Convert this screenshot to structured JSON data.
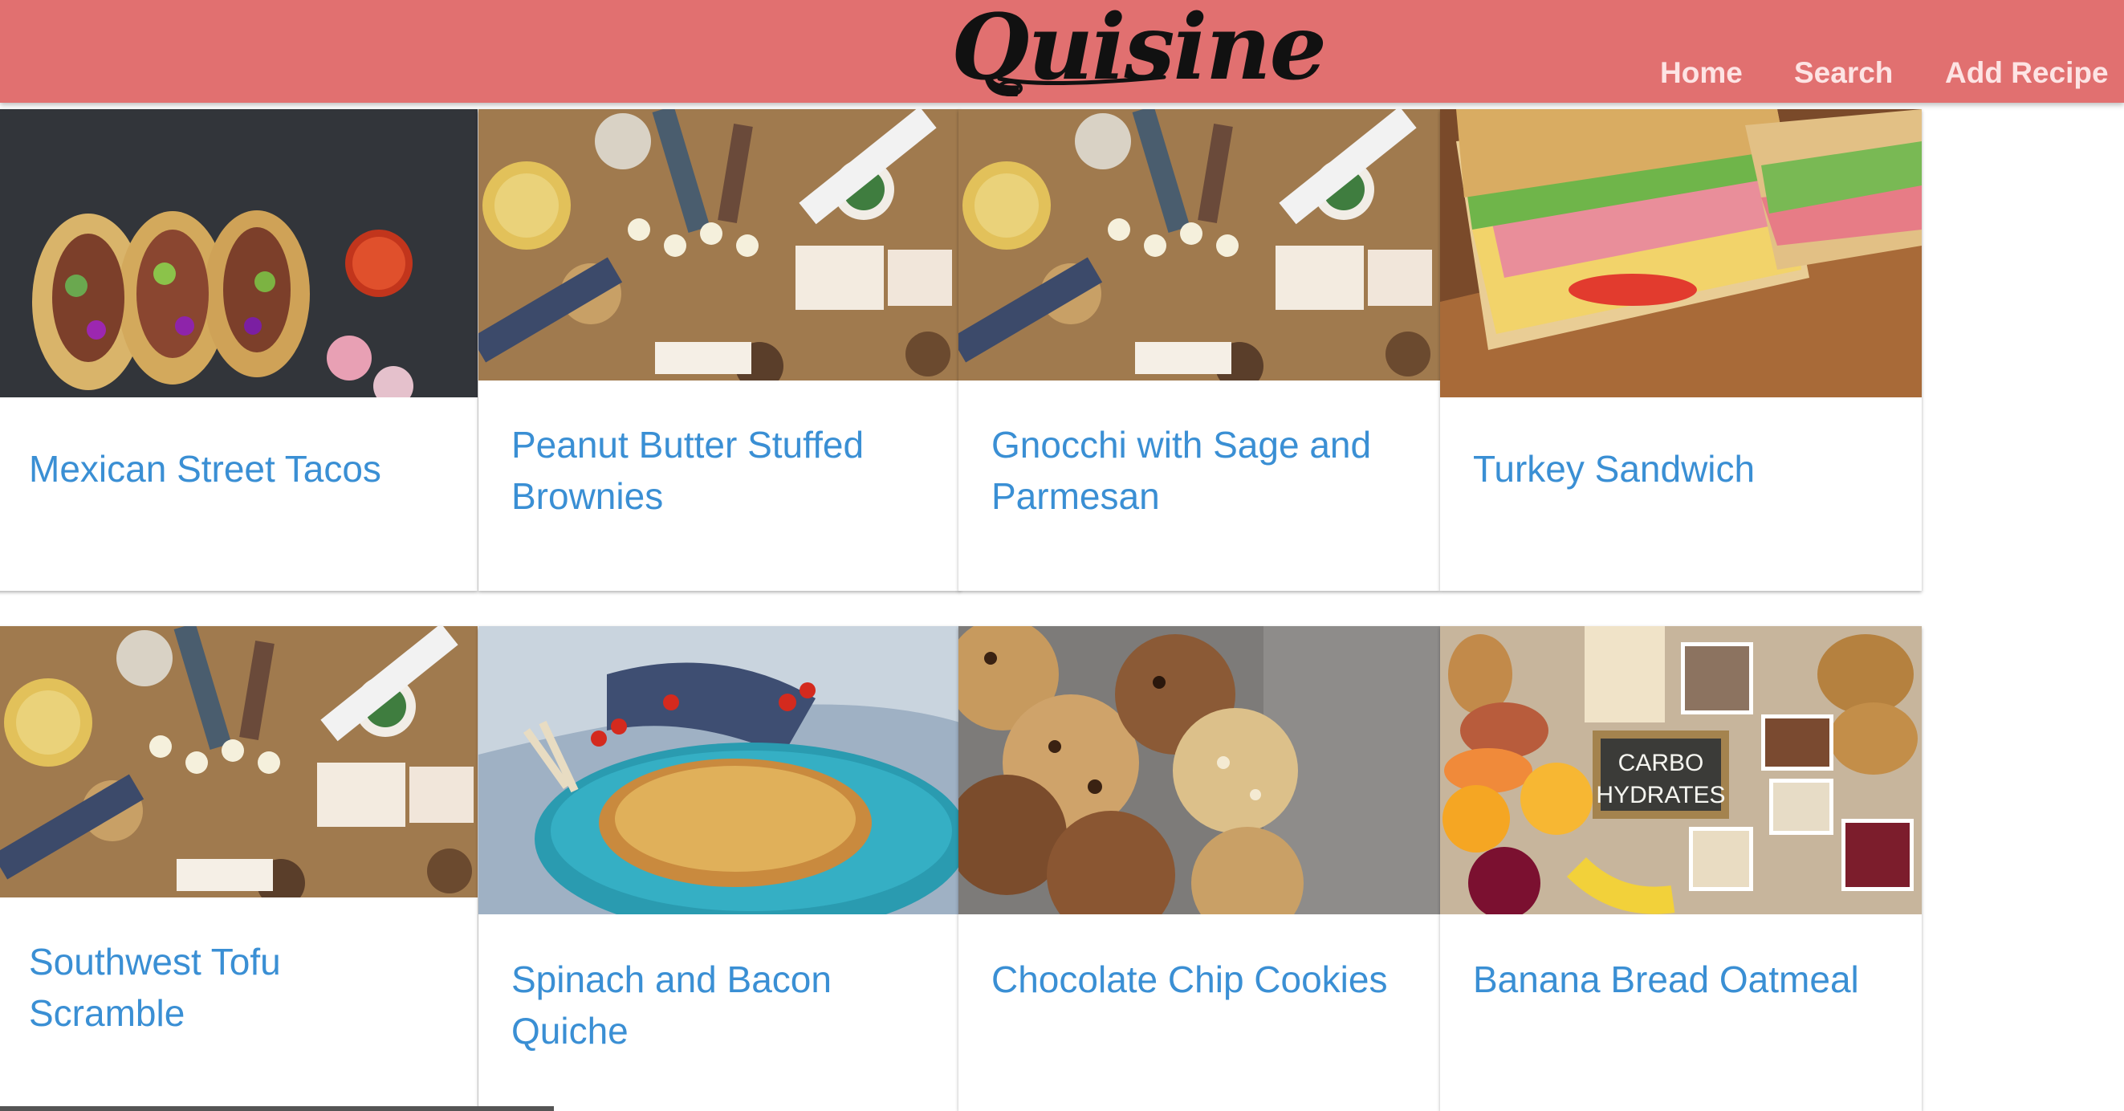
{
  "header": {
    "logo": "Quisine",
    "nav": {
      "home": "Home",
      "search": "Search",
      "add_recipe": "Add Recipe"
    }
  },
  "recipes": [
    {
      "title": "Mexican Street Tacos",
      "image": "tacos-photo"
    },
    {
      "title": "Peanut Butter Stuffed Brownies",
      "image": "dinner-table-photo"
    },
    {
      "title": "Gnocchi with Sage and Parmesan",
      "image": "dinner-table-photo"
    },
    {
      "title": "Turkey Sandwich",
      "image": "sandwich-photo"
    },
    {
      "title": "Southwest Tofu Scramble",
      "image": "dinner-table-photo"
    },
    {
      "title": "Spinach and Bacon Quiche",
      "image": "quiche-photo"
    },
    {
      "title": "Chocolate Chip Cookies",
      "image": "cookies-photo"
    },
    {
      "title": "Banana Bread Oatmeal",
      "image": "carbohydrates-photo",
      "image_text": "CARBO HYDRATES"
    }
  ],
  "colors": {
    "navbar": "#e17070",
    "link": "#3a8fd4",
    "nav_text": "#fde4e4"
  }
}
